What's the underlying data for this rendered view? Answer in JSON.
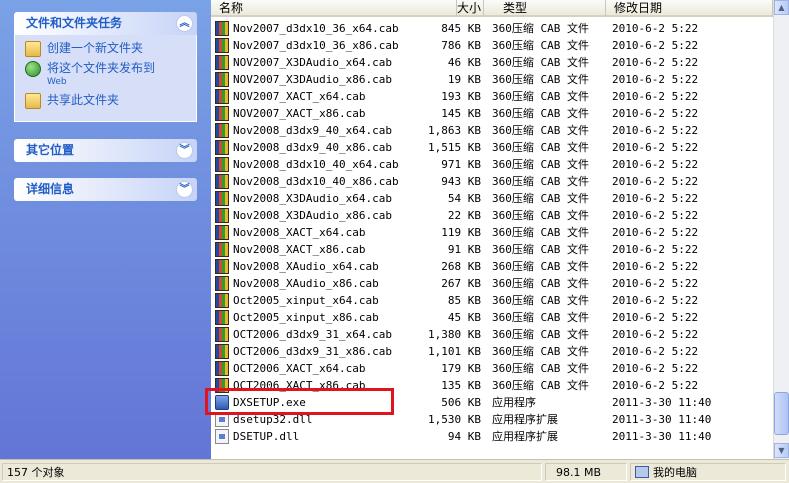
{
  "task_pane": {
    "panels": [
      {
        "title": "文件和文件夹任务",
        "expanded": true,
        "tasks": [
          {
            "label": "创建一个新文件夹",
            "icon": "new-folder-icon"
          },
          {
            "label": "将这个文件夹发布到",
            "sub": "Web",
            "icon": "publish-web-icon"
          },
          {
            "label": "共享此文件夹",
            "icon": "share-folder-icon"
          }
        ]
      },
      {
        "title": "其它位置",
        "expanded": false
      },
      {
        "title": "详细信息",
        "expanded": false
      }
    ]
  },
  "columns": {
    "name": "名称",
    "size": "大小",
    "type": "类型",
    "date": "修改日期"
  },
  "files": [
    {
      "name": "Nov2007_d3dx10_36_x64.cab",
      "size": "845 KB",
      "type": "360压缩 CAB 文件",
      "date": "2010-6-2 5:22",
      "icon": "cab-file-icon"
    },
    {
      "name": "Nov2007_d3dx10_36_x86.cab",
      "size": "786 KB",
      "type": "360压缩 CAB 文件",
      "date": "2010-6-2 5:22",
      "icon": "cab-file-icon"
    },
    {
      "name": "NOV2007_X3DAudio_x64.cab",
      "size": "46 KB",
      "type": "360压缩 CAB 文件",
      "date": "2010-6-2 5:22",
      "icon": "cab-file-icon"
    },
    {
      "name": "NOV2007_X3DAudio_x86.cab",
      "size": "19 KB",
      "type": "360压缩 CAB 文件",
      "date": "2010-6-2 5:22",
      "icon": "cab-file-icon"
    },
    {
      "name": "NOV2007_XACT_x64.cab",
      "size": "193 KB",
      "type": "360压缩 CAB 文件",
      "date": "2010-6-2 5:22",
      "icon": "cab-file-icon"
    },
    {
      "name": "NOV2007_XACT_x86.cab",
      "size": "145 KB",
      "type": "360压缩 CAB 文件",
      "date": "2010-6-2 5:22",
      "icon": "cab-file-icon"
    },
    {
      "name": "Nov2008_d3dx9_40_x64.cab",
      "size": "1,863 KB",
      "type": "360压缩 CAB 文件",
      "date": "2010-6-2 5:22",
      "icon": "cab-file-icon"
    },
    {
      "name": "Nov2008_d3dx9_40_x86.cab",
      "size": "1,515 KB",
      "type": "360压缩 CAB 文件",
      "date": "2010-6-2 5:22",
      "icon": "cab-file-icon"
    },
    {
      "name": "Nov2008_d3dx10_40_x64.cab",
      "size": "971 KB",
      "type": "360压缩 CAB 文件",
      "date": "2010-6-2 5:22",
      "icon": "cab-file-icon"
    },
    {
      "name": "Nov2008_d3dx10_40_x86.cab",
      "size": "943 KB",
      "type": "360压缩 CAB 文件",
      "date": "2010-6-2 5:22",
      "icon": "cab-file-icon"
    },
    {
      "name": "Nov2008_X3DAudio_x64.cab",
      "size": "54 KB",
      "type": "360压缩 CAB 文件",
      "date": "2010-6-2 5:22",
      "icon": "cab-file-icon"
    },
    {
      "name": "Nov2008_X3DAudio_x86.cab",
      "size": "22 KB",
      "type": "360压缩 CAB 文件",
      "date": "2010-6-2 5:22",
      "icon": "cab-file-icon"
    },
    {
      "name": "Nov2008_XACT_x64.cab",
      "size": "119 KB",
      "type": "360压缩 CAB 文件",
      "date": "2010-6-2 5:22",
      "icon": "cab-file-icon"
    },
    {
      "name": "Nov2008_XACT_x86.cab",
      "size": "91 KB",
      "type": "360压缩 CAB 文件",
      "date": "2010-6-2 5:22",
      "icon": "cab-file-icon"
    },
    {
      "name": "Nov2008_XAudio_x64.cab",
      "size": "268 KB",
      "type": "360压缩 CAB 文件",
      "date": "2010-6-2 5:22",
      "icon": "cab-file-icon"
    },
    {
      "name": "Nov2008_XAudio_x86.cab",
      "size": "267 KB",
      "type": "360压缩 CAB 文件",
      "date": "2010-6-2 5:22",
      "icon": "cab-file-icon"
    },
    {
      "name": "Oct2005_xinput_x64.cab",
      "size": "85 KB",
      "type": "360压缩 CAB 文件",
      "date": "2010-6-2 5:22",
      "icon": "cab-file-icon"
    },
    {
      "name": "Oct2005_xinput_x86.cab",
      "size": "45 KB",
      "type": "360压缩 CAB 文件",
      "date": "2010-6-2 5:22",
      "icon": "cab-file-icon"
    },
    {
      "name": "OCT2006_d3dx9_31_x64.cab",
      "size": "1,380 KB",
      "type": "360压缩 CAB 文件",
      "date": "2010-6-2 5:22",
      "icon": "cab-file-icon"
    },
    {
      "name": "OCT2006_d3dx9_31_x86.cab",
      "size": "1,101 KB",
      "type": "360压缩 CAB 文件",
      "date": "2010-6-2 5:22",
      "icon": "cab-file-icon"
    },
    {
      "name": "OCT2006_XACT_x64.cab",
      "size": "179 KB",
      "type": "360压缩 CAB 文件",
      "date": "2010-6-2 5:22",
      "icon": "cab-file-icon"
    },
    {
      "name": "OCT2006_XACT_x86.cab",
      "size": "135 KB",
      "type": "360压缩 CAB 文件",
      "date": "2010-6-2 5:22",
      "icon": "cab-file-icon"
    },
    {
      "name": "DXSETUP.exe",
      "size": "506 KB",
      "type": "应用程序",
      "date": "2011-3-30 11:40",
      "icon": "exe-file-icon"
    },
    {
      "name": "dsetup32.dll",
      "size": "1,530 KB",
      "type": "应用程序扩展",
      "date": "2011-3-30 11:40",
      "icon": "dll-file-icon"
    },
    {
      "name": "DSETUP.dll",
      "size": "94 KB",
      "type": "应用程序扩展",
      "date": "2011-3-30 11:40",
      "icon": "dll-file-icon"
    }
  ],
  "status": {
    "object_count": "157 个对象",
    "size": "98.1 MB",
    "location": "我的电脑"
  },
  "colors": {
    "highlight_box": "#e0141e",
    "task_link": "#215dc6",
    "pane_bg": "#6375d6"
  }
}
